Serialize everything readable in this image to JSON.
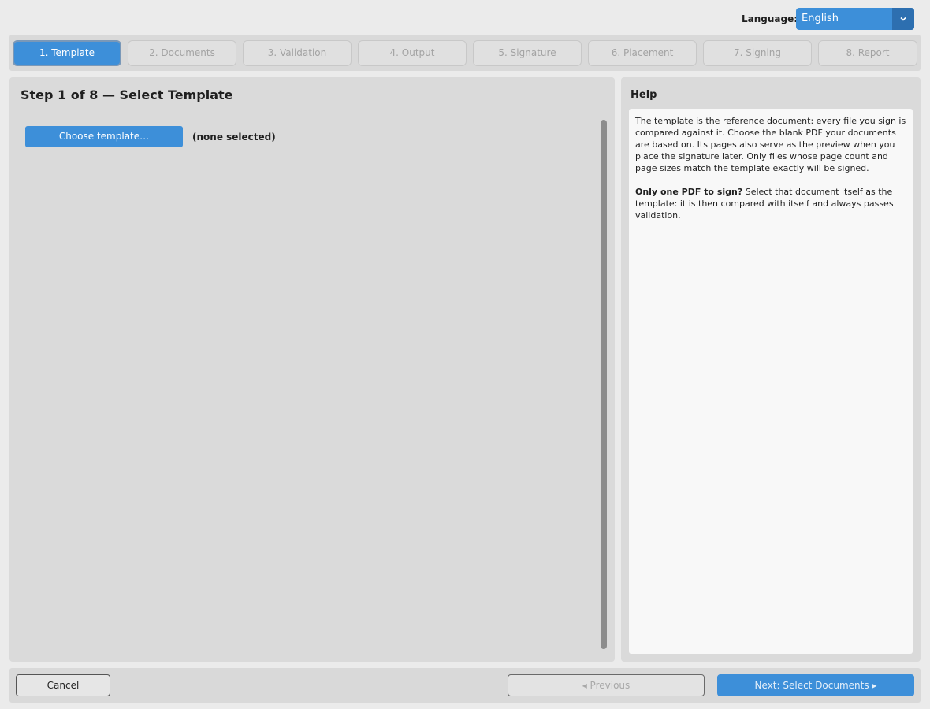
{
  "language": {
    "label": "Language:",
    "selected": "English",
    "dropdown_icon": "chevron-down-icon"
  },
  "tabs": [
    {
      "label": "1. Template",
      "active": true
    },
    {
      "label": "2. Documents",
      "active": false
    },
    {
      "label": "3. Validation",
      "active": false
    },
    {
      "label": "4. Output",
      "active": false
    },
    {
      "label": "5. Signature",
      "active": false
    },
    {
      "label": "6. Placement",
      "active": false
    },
    {
      "label": "7. Signing",
      "active": false
    },
    {
      "label": "8. Report",
      "active": false
    }
  ],
  "main": {
    "title": "Step 1 of 8 — Select Template",
    "choose_button": "Choose template…",
    "selected_file": "(none selected)"
  },
  "help": {
    "title": "Help",
    "paragraph1": "The template is the reference document: every file you sign is compared against it. Choose the blank PDF your documents are based on. Its pages also serve as the preview when you place the signature later. Only files whose page count and page sizes match the template exactly will be signed.",
    "paragraph2_bold": "Only one PDF to sign?",
    "paragraph2_rest": " Select that document itself as the template: it is then compared with itself and always passes validation."
  },
  "footer": {
    "cancel": "Cancel",
    "previous": "◂  Previous",
    "next": "Next: Select Documents  ▸"
  },
  "colors": {
    "accent": "#3d8fd9",
    "accent_dark": "#2d6fb0",
    "panel": "#dadada",
    "background": "#ebebeb"
  }
}
